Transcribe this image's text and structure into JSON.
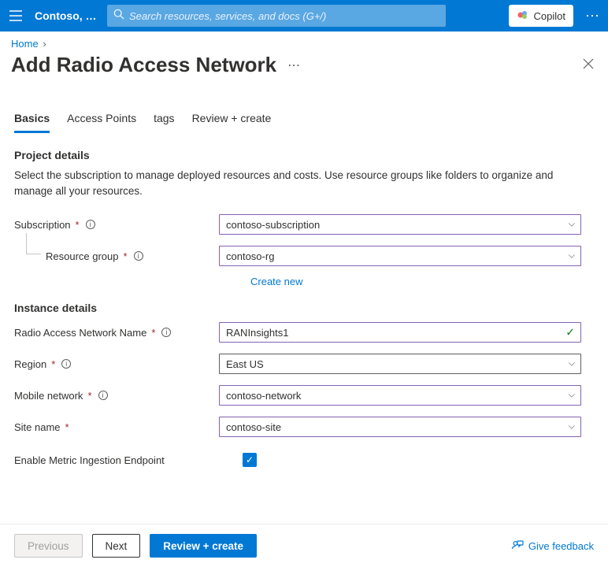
{
  "header": {
    "tenant": "Contoso, L...",
    "search_placeholder": "Search resources, services, and docs (G+/)",
    "copilot_label": "Copilot"
  },
  "breadcrumb": {
    "home": "Home"
  },
  "page": {
    "title": "Add Radio Access Network"
  },
  "tabs": {
    "basics": "Basics",
    "access_points": "Access Points",
    "tags": "tags",
    "review": "Review + create"
  },
  "sections": {
    "project_details": {
      "title": "Project details",
      "desc": "Select the subscription to manage deployed resources and costs. Use resource groups like folders to organize and manage all your resources."
    },
    "instance_details": {
      "title": "Instance details"
    }
  },
  "fields": {
    "subscription": {
      "label": "Subscription",
      "value": "contoso-subscription"
    },
    "resource_group": {
      "label": "Resource group",
      "value": "contoso-rg",
      "create_new": "Create new"
    },
    "ran_name": {
      "label": "Radio Access Network Name",
      "value": "RANInsights1"
    },
    "region": {
      "label": "Region",
      "value": "East US"
    },
    "mobile_network": {
      "label": "Mobile network",
      "value": "contoso-network"
    },
    "site_name": {
      "label": "Site name",
      "value": "contoso-site"
    },
    "enable_metric": {
      "label": "Enable Metric Ingestion Endpoint",
      "checked": true
    }
  },
  "footer": {
    "previous": "Previous",
    "next": "Next",
    "review_create": "Review + create",
    "feedback": "Give feedback"
  }
}
